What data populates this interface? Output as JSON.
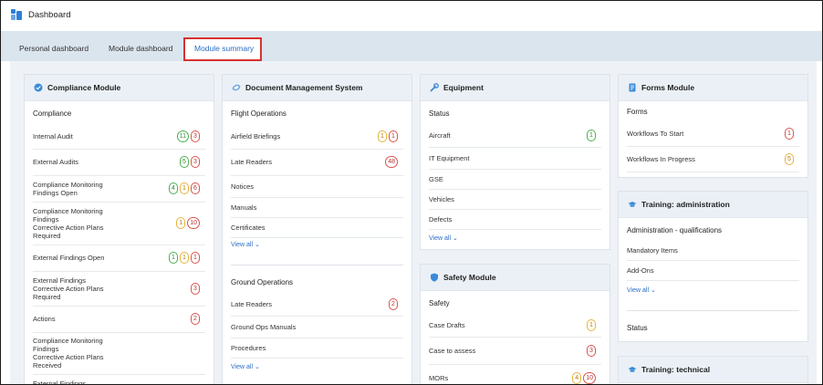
{
  "app": {
    "title": "Dashboard"
  },
  "tabs": [
    {
      "label": "Personal dashboard"
    },
    {
      "label": "Module dashboard"
    },
    {
      "label": "Module summary"
    }
  ],
  "compliance": {
    "title": "Compliance Module",
    "section": "Compliance",
    "rows": [
      {
        "label": "Internal Audit",
        "badges": [
          "11",
          "3"
        ]
      },
      {
        "label": "External Audits",
        "badges": [
          "5",
          "3"
        ]
      },
      {
        "label": "Compliance Monitoring\nFindings Open",
        "badges": [
          "4",
          "1",
          "6"
        ]
      },
      {
        "label": "Compliance Monitoring\nFindings\nCorrective Action Plans\nRequired",
        "badges": [
          "1",
          "10"
        ]
      },
      {
        "label": "External Findings Open",
        "badges": [
          "1",
          "1",
          "1"
        ]
      },
      {
        "label": "External Findings\nCorrective Action Plans\nRequired",
        "badges": [
          "3"
        ]
      },
      {
        "label": "Actions",
        "badges": [
          "2"
        ]
      },
      {
        "label": "Compliance Monitoring\nFindings\nCorrective Action Plans\nReceived",
        "badges": []
      },
      {
        "label": "External Findings",
        "badges": []
      }
    ]
  },
  "dms": {
    "title": "Document Management System",
    "flight_section": "Flight Operations",
    "flight_rows": [
      {
        "label": "Airfield Briefings",
        "badges": [
          "1",
          "1"
        ]
      },
      {
        "label": "Late Readers",
        "badges": [
          "48"
        ]
      },
      {
        "label": "Notices",
        "badges": []
      },
      {
        "label": "Manuals",
        "badges": []
      },
      {
        "label": "Certificates",
        "badges": []
      }
    ],
    "view_all_1": "View all",
    "ground_section": "Ground Operations",
    "ground_rows": [
      {
        "label": "Late Readers",
        "badges": [
          "2"
        ]
      },
      {
        "label": "Ground Ops Manuals",
        "badges": []
      },
      {
        "label": "Procedures",
        "badges": []
      }
    ],
    "view_all_2": "View all"
  },
  "equipment": {
    "title": "Equipment",
    "section": "Status",
    "rows": [
      {
        "label": "Aircraft",
        "badges": [
          "1"
        ]
      },
      {
        "label": "IT Equipment",
        "badges": []
      },
      {
        "label": "GSE",
        "badges": []
      },
      {
        "label": "Vehicles",
        "badges": []
      },
      {
        "label": "Defects",
        "badges": []
      }
    ],
    "view_all": "View all"
  },
  "safety": {
    "title": "Safety Module",
    "section": "Safety",
    "rows": [
      {
        "label": "Case Drafts",
        "badges": [
          "1"
        ]
      },
      {
        "label": "Case to assess",
        "badges": [
          "3"
        ]
      },
      {
        "label": "MORs",
        "badges": [
          "4",
          "10"
        ]
      }
    ]
  },
  "forms": {
    "title": "Forms Module",
    "section": "Forms",
    "rows": [
      {
        "label": "Workflows To Start",
        "badges": [
          "1"
        ]
      },
      {
        "label": "Workflows In Progress",
        "badges": [
          "5"
        ]
      }
    ]
  },
  "training_admin": {
    "title": "Training: administration",
    "section": "Administration - qualifications",
    "rows": [
      {
        "label": "Mandatory Items",
        "badges": []
      },
      {
        "label": "Add-Ons",
        "badges": []
      }
    ],
    "view_all": "View all",
    "status": "Status"
  },
  "training_tech": {
    "title": "Training: technical"
  },
  "colors": {
    "green": "#4bb04f",
    "red": "#d9534f",
    "yellow": "#e8b33a",
    "accent": "#2b6cc4",
    "highlight": "#d93030"
  }
}
